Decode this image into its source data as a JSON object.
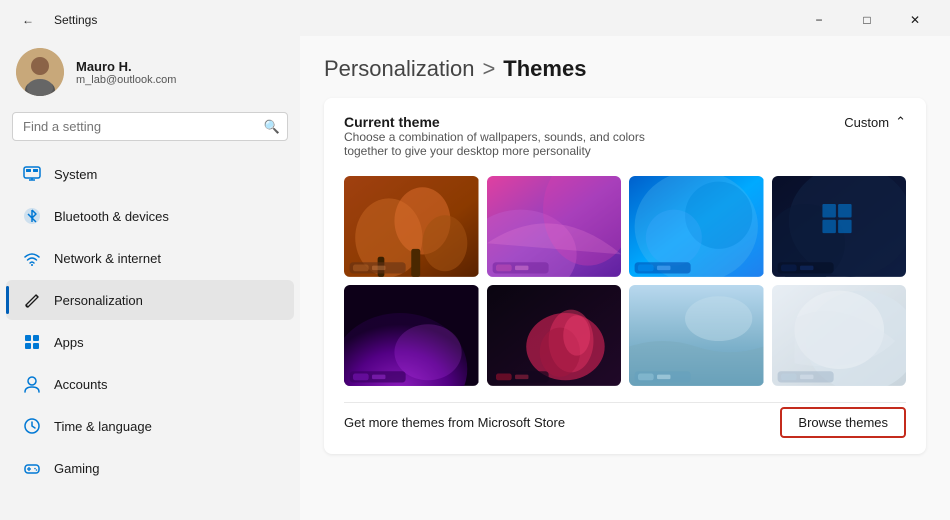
{
  "titlebar": {
    "title": "Settings",
    "minimize_label": "−",
    "maximize_label": "□",
    "close_label": "✕"
  },
  "sidebar": {
    "search_placeholder": "Find a setting",
    "user": {
      "name": "Mauro H.",
      "email": "m_lab@outlook.com"
    },
    "nav_items": [
      {
        "id": "system",
        "label": "System",
        "icon": "monitor",
        "active": false
      },
      {
        "id": "bluetooth",
        "label": "Bluetooth & devices",
        "icon": "bluetooth",
        "active": false
      },
      {
        "id": "network",
        "label": "Network & internet",
        "icon": "wifi",
        "active": false
      },
      {
        "id": "personalization",
        "label": "Personalization",
        "icon": "brush",
        "active": true
      },
      {
        "id": "apps",
        "label": "Apps",
        "icon": "apps",
        "active": false
      },
      {
        "id": "accounts",
        "label": "Accounts",
        "icon": "person",
        "active": false
      },
      {
        "id": "time",
        "label": "Time & language",
        "icon": "clock",
        "active": false
      },
      {
        "id": "gaming",
        "label": "Gaming",
        "icon": "gamepad",
        "active": false
      }
    ]
  },
  "content": {
    "breadcrumb_parent": "Personalization",
    "breadcrumb_sep": ">",
    "breadcrumb_current": "Themes",
    "current_theme_title": "Current theme",
    "current_theme_desc": "Choose a combination of wallpapers, sounds, and colors together to give your desktop more personality",
    "current_theme_value": "Custom",
    "browse_text": "Get more themes from Microsoft Store",
    "browse_button": "Browse themes",
    "themes": [
      {
        "id": 1,
        "colors": [
          "#8B3A00",
          "#B35A10",
          "#6B2800",
          "#D4711A"
        ],
        "type": "autumn"
      },
      {
        "id": 2,
        "colors": [
          "#E040A0",
          "#C060D0",
          "#8040B0",
          "#B070D0"
        ],
        "type": "abstract-pink"
      },
      {
        "id": 3,
        "colors": [
          "#0088DD",
          "#00AAFF",
          "#2060C0",
          "#55BBEE"
        ],
        "type": "windows-blue"
      },
      {
        "id": 4,
        "colors": [
          "#0A1A3A",
          "#1A2B5C",
          "#0D1E45",
          "#122040"
        ],
        "type": "dark-blue"
      },
      {
        "id": 5,
        "colors": [
          "#4B0080",
          "#8B20C0",
          "#2A0060",
          "#6A10A0"
        ],
        "type": "purple-dark"
      },
      {
        "id": 6,
        "colors": [
          "#1A0A20",
          "#C03060",
          "#E04080",
          "#8B1040"
        ],
        "type": "flower-dark"
      },
      {
        "id": 7,
        "colors": [
          "#A8C8D8",
          "#7AAABB",
          "#D8E8EE",
          "#9BB8C8"
        ],
        "type": "light-blue"
      },
      {
        "id": 8,
        "colors": [
          "#D0D8E0",
          "#B8C8D4",
          "#E8EEF2",
          "#C4D0DC"
        ],
        "type": "light-grey"
      }
    ]
  }
}
